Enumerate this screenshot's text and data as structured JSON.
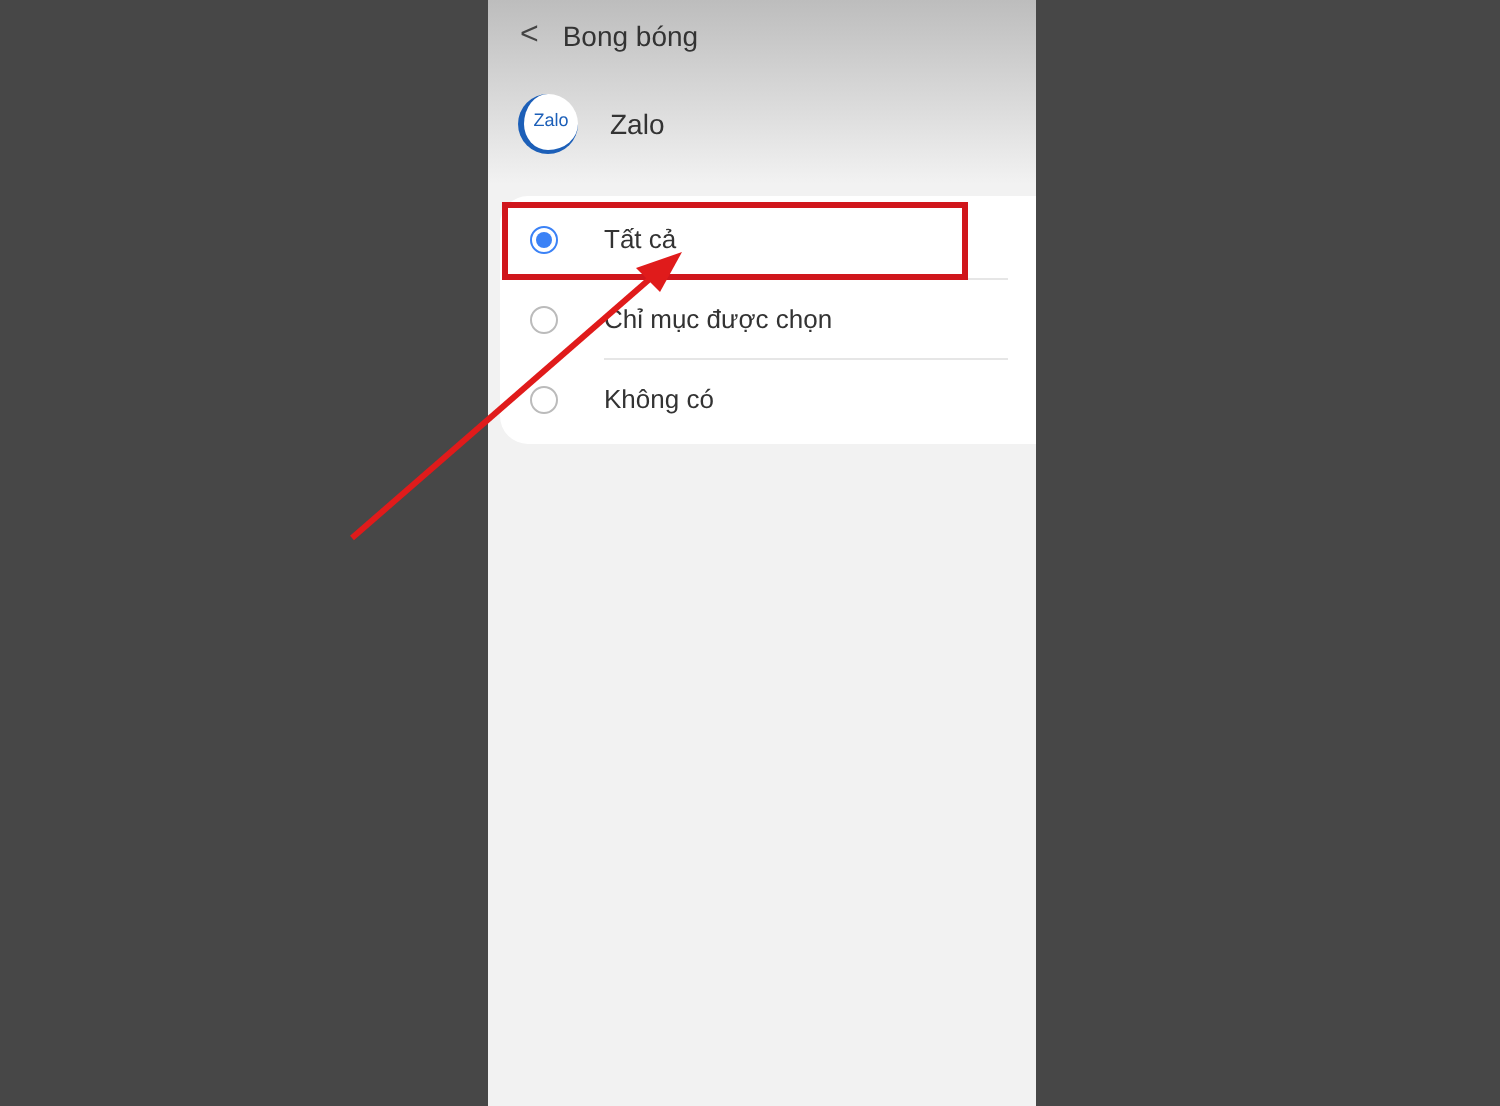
{
  "header": {
    "back": "<",
    "title": "Bong bóng"
  },
  "app": {
    "logo_text": "Zalo",
    "name": "Zalo"
  },
  "options": [
    {
      "label": "Tất cả",
      "selected": true,
      "highlighted": true
    },
    {
      "label": "Chỉ mục được chọn",
      "selected": false,
      "highlighted": false
    },
    {
      "label": "Không có",
      "selected": false,
      "highlighted": false
    }
  ]
}
